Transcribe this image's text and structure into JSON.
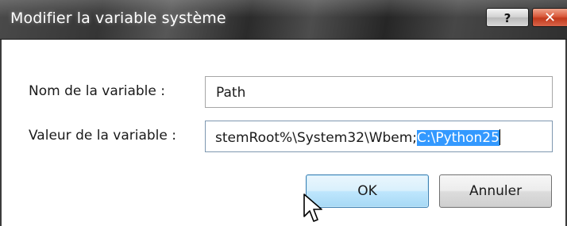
{
  "window": {
    "title": "Modifier la variable système",
    "help_label": "?",
    "close_label": "✕"
  },
  "form": {
    "name_label": "Nom de la variable :",
    "name_value": "Path",
    "value_label": "Valeur de la variable :",
    "value_text": "stemRoot%\\System32\\Wbem;",
    "value_selected": "C:\\Python25"
  },
  "buttons": {
    "ok_label": "OK",
    "cancel_label": "Annuler"
  },
  "icons": [
    "help-icon",
    "close-icon",
    "mouse-pointer-icon"
  ]
}
